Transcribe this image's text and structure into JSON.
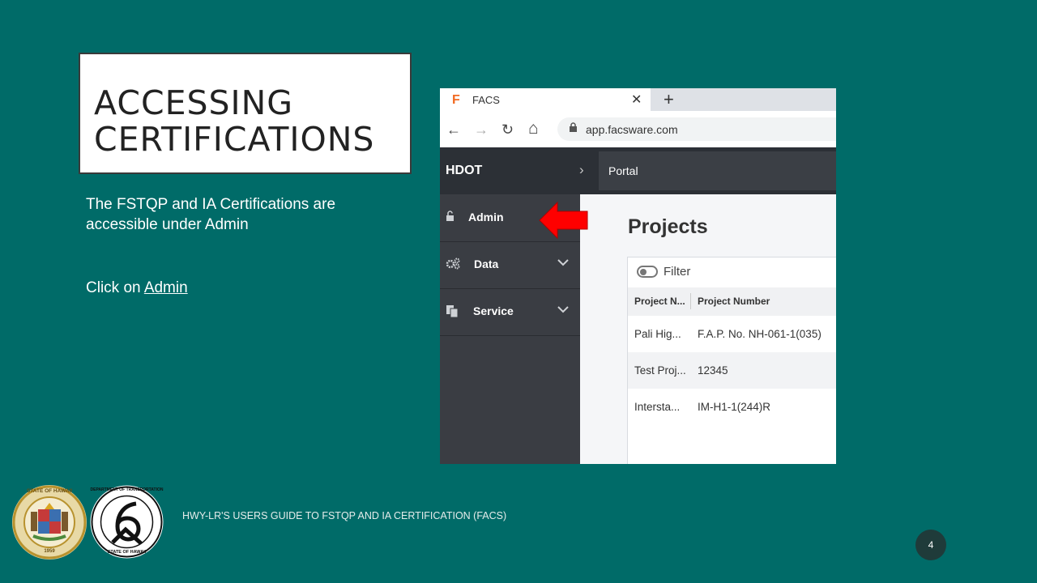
{
  "slide": {
    "title_line1": "ACCESSING",
    "title_line2": "CERTIFICATIONS",
    "paragraph1_line1": "The FSTQP and IA Certifications are",
    "paragraph1_line2": "accessible under Admin",
    "click_prefix": "Click on ",
    "click_link": "Admin",
    "footer": "HWY-LR'S USERS GUIDE TO FSTQP AND IA CERTIFICATION (FACS)",
    "page_number": "4"
  },
  "seals": {
    "state_top_text": "STATE OF HAWAII",
    "state_year": "1959",
    "dot_top_text": "DEPARTMENT OF TRANSPORTATION",
    "dot_bottom_text": "STATE OF HAWAII"
  },
  "browser": {
    "tab_logo": "F",
    "tab_title": "FACS",
    "tab_close": "✕",
    "new_tab": "+",
    "back": "←",
    "forward": "→",
    "reload": "↻",
    "home": "⌂",
    "url": "app.facsware.com"
  },
  "app": {
    "brand": "HDOT",
    "breadcrumb_chevron": "›",
    "breadcrumb": "Portal",
    "sidebar": [
      {
        "label": "Admin",
        "icon": "unlock-icon"
      },
      {
        "label": "Data",
        "icon": "gears-icon"
      },
      {
        "label": "Service",
        "icon": "documents-icon"
      }
    ],
    "page_title": "Projects",
    "filter_label": "Filter",
    "columns": [
      "Project N...",
      "Project Number"
    ],
    "rows": [
      [
        "Pali Hig...",
        "F.A.P. No. NH-061-1(035)"
      ],
      [
        "Test Proj...",
        "12345"
      ],
      [
        "Intersta...",
        "IM-H1-1(244)R"
      ]
    ]
  },
  "colors": {
    "background": "#006b68",
    "arrow": "#ff0000",
    "sidebar": "#3a3d43",
    "topbar": "#2c3036"
  }
}
